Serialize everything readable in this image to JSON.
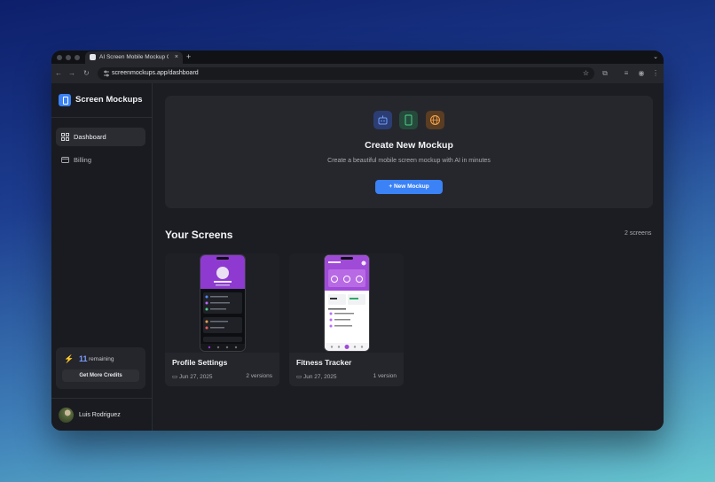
{
  "browser": {
    "tab_title": "AI Screen Mobile Mockup Ge",
    "tab_close": "×",
    "new_tab": "+",
    "url": "screenmockups.app/dashboard"
  },
  "sidebar": {
    "brand": "Screen Mockups",
    "items": [
      {
        "label": "Dashboard",
        "icon": "dashboard-icon",
        "active": true
      },
      {
        "label": "Billing",
        "icon": "credit-card-icon",
        "active": false
      }
    ],
    "credits": {
      "count": "11",
      "label": "remaining",
      "button": "Get More Credits"
    },
    "user": {
      "name": "Luis Rodriguez"
    }
  },
  "hero": {
    "icons": [
      "robot-icon",
      "phone-icon",
      "globe-icon"
    ],
    "title": "Create New Mockup",
    "subtitle": "Create a beautiful mobile screen mockup with AI in minutes",
    "button": "New Mockup"
  },
  "screens": {
    "title": "Your Screens",
    "count": "2 screens",
    "items": [
      {
        "name": "Profile Settings",
        "date": "Jun 27, 2025",
        "versions": "2 versions"
      },
      {
        "name": "Fitness Tracker",
        "date": "Jun 27, 2025",
        "versions": "1 version"
      }
    ]
  },
  "colors": {
    "accent": "#3b82f6",
    "credits": "#7d9bff",
    "phone_header": "#9b3fd6"
  }
}
